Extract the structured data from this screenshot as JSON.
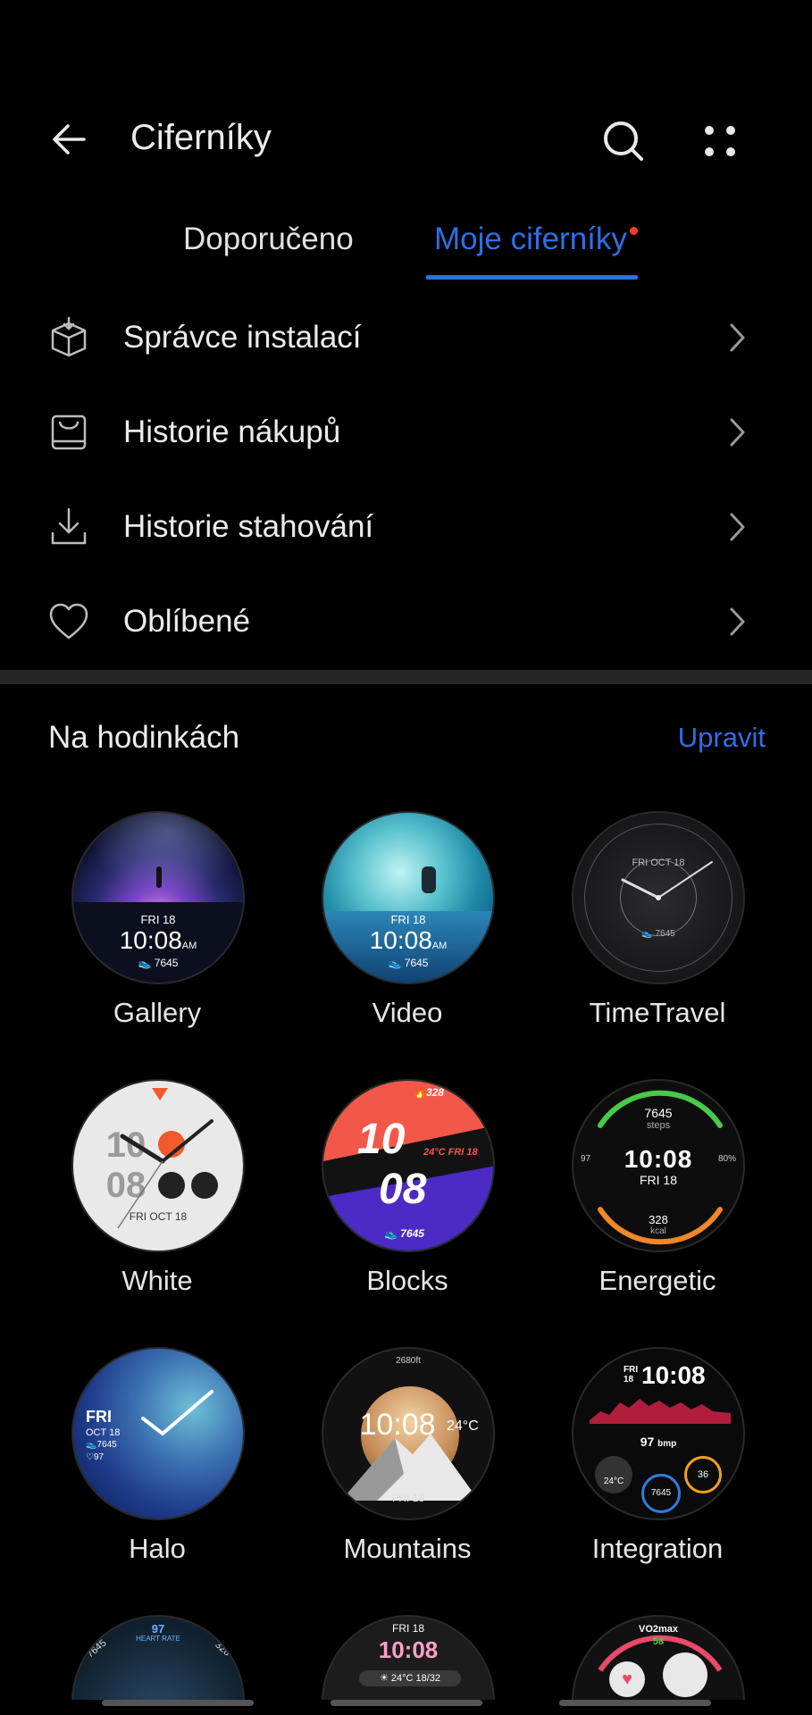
{
  "header": {
    "title": "Ciferníky"
  },
  "tabs": [
    {
      "label": "Doporučeno",
      "active": false
    },
    {
      "label": "Moje ciferníky",
      "active": true
    }
  ],
  "menu": [
    {
      "label": "Správce instalací",
      "icon": "box-install-icon"
    },
    {
      "label": "Historie nákupů",
      "icon": "purchase-bag-icon"
    },
    {
      "label": "Historie stahování",
      "icon": "download-icon"
    },
    {
      "label": "Oblíbené",
      "icon": "heart-icon"
    }
  ],
  "section": {
    "title": "Na hodinkách",
    "edit_label": "Upravit"
  },
  "faces": [
    {
      "name": "Gallery",
      "date": "FRI 18",
      "time": "10:08",
      "ampm": "AM",
      "steps": "7645"
    },
    {
      "name": "Video",
      "date": "FRI 18",
      "time": "10:08",
      "ampm": "AM",
      "steps": "7645"
    },
    {
      "name": "TimeTravel",
      "date": "FRI OCT 18",
      "steps": "7645"
    },
    {
      "name": "White",
      "hour": "10",
      "minute": "08",
      "date": "FRI OCT 18"
    },
    {
      "name": "Blocks",
      "kcal": "328",
      "hour": "10",
      "minute": "08",
      "temp_date": "24°C FRI 18",
      "steps": "7645"
    },
    {
      "name": "Energetic",
      "steps": "7645",
      "steps_unit": "steps",
      "time": "10:08",
      "date": "FRI 18",
      "heart": "97",
      "battery": "80%",
      "kcal": "328",
      "kcal_unit": "kcal"
    },
    {
      "name": "Halo",
      "day": "FRI",
      "date": "OCT 18",
      "steps": "7645",
      "heart": "97"
    },
    {
      "name": "Mountains",
      "time": "10:08",
      "temp": "24°C",
      "date": "FRI 18",
      "altitude": "2680ft"
    },
    {
      "name": "Integration",
      "day": "FRI",
      "daynum": "18",
      "time": "10:08",
      "bpm": "97",
      "bpm_unit": "bmp",
      "temp": "24°C",
      "steps": "7645",
      "stat": "36"
    },
    {
      "name": "",
      "heart": "97",
      "heart_label": "HEART RATE",
      "steps": "7645",
      "kcal": "328"
    },
    {
      "name": "",
      "date": "FRI 18",
      "time": "10:08",
      "weather": "24°C 18/32"
    },
    {
      "name": "",
      "label": "VO2max",
      "value": "58"
    }
  ],
  "colors": {
    "accent": "#2f6fe4",
    "background": "#000000",
    "notification_dot": "#ff3b30"
  }
}
